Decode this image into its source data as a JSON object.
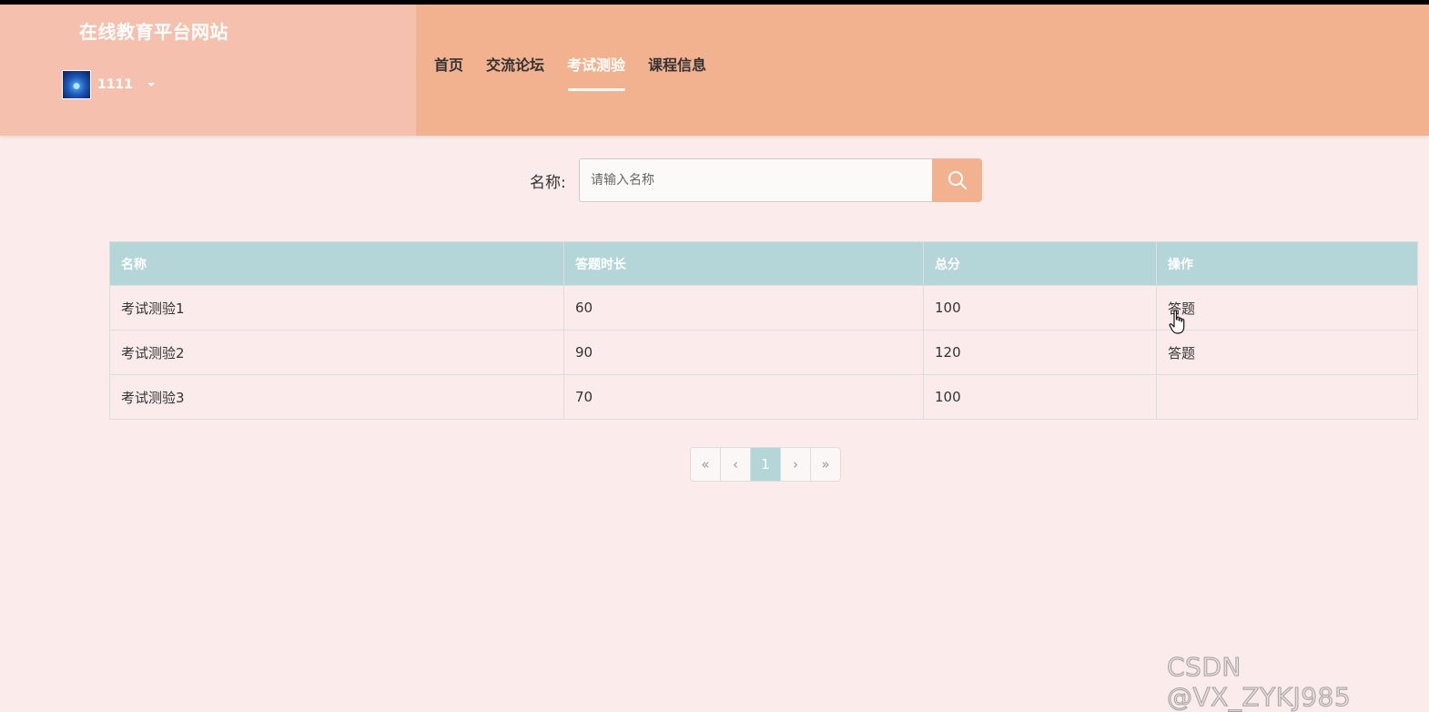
{
  "header": {
    "site_title": "在线教育平台网站",
    "username": "1111",
    "nav": [
      {
        "label": "首页",
        "active": false
      },
      {
        "label": "交流论坛",
        "active": false
      },
      {
        "label": "考试测验",
        "active": true
      },
      {
        "label": "课程信息",
        "active": false
      }
    ]
  },
  "search": {
    "label": "名称:",
    "placeholder": "请输入名称",
    "value": ""
  },
  "table": {
    "columns": [
      "名称",
      "答题时长",
      "总分",
      "操作"
    ],
    "rows": [
      {
        "name": "考试测验1",
        "duration": "60",
        "score": "100",
        "action": "答题"
      },
      {
        "name": "考试测验2",
        "duration": "90",
        "score": "120",
        "action": "答题"
      },
      {
        "name": "考试测验3",
        "duration": "70",
        "score": "100",
        "action": ""
      }
    ]
  },
  "pagination": {
    "first": "«",
    "prev": "‹",
    "current": "1",
    "next": "›",
    "last": "»"
  },
  "watermark": "CSDN @VX_ZYKJ985",
  "colors": {
    "header_bg": "#f2b290",
    "brand_bg": "#f5c1ae",
    "page_bg": "#fbeceb",
    "table_header_bg": "#b4d6d9"
  },
  "icons": {
    "search_button": "search-icon",
    "user_menu": "caret-down-icon",
    "pointer": "hand-cursor-icon"
  }
}
